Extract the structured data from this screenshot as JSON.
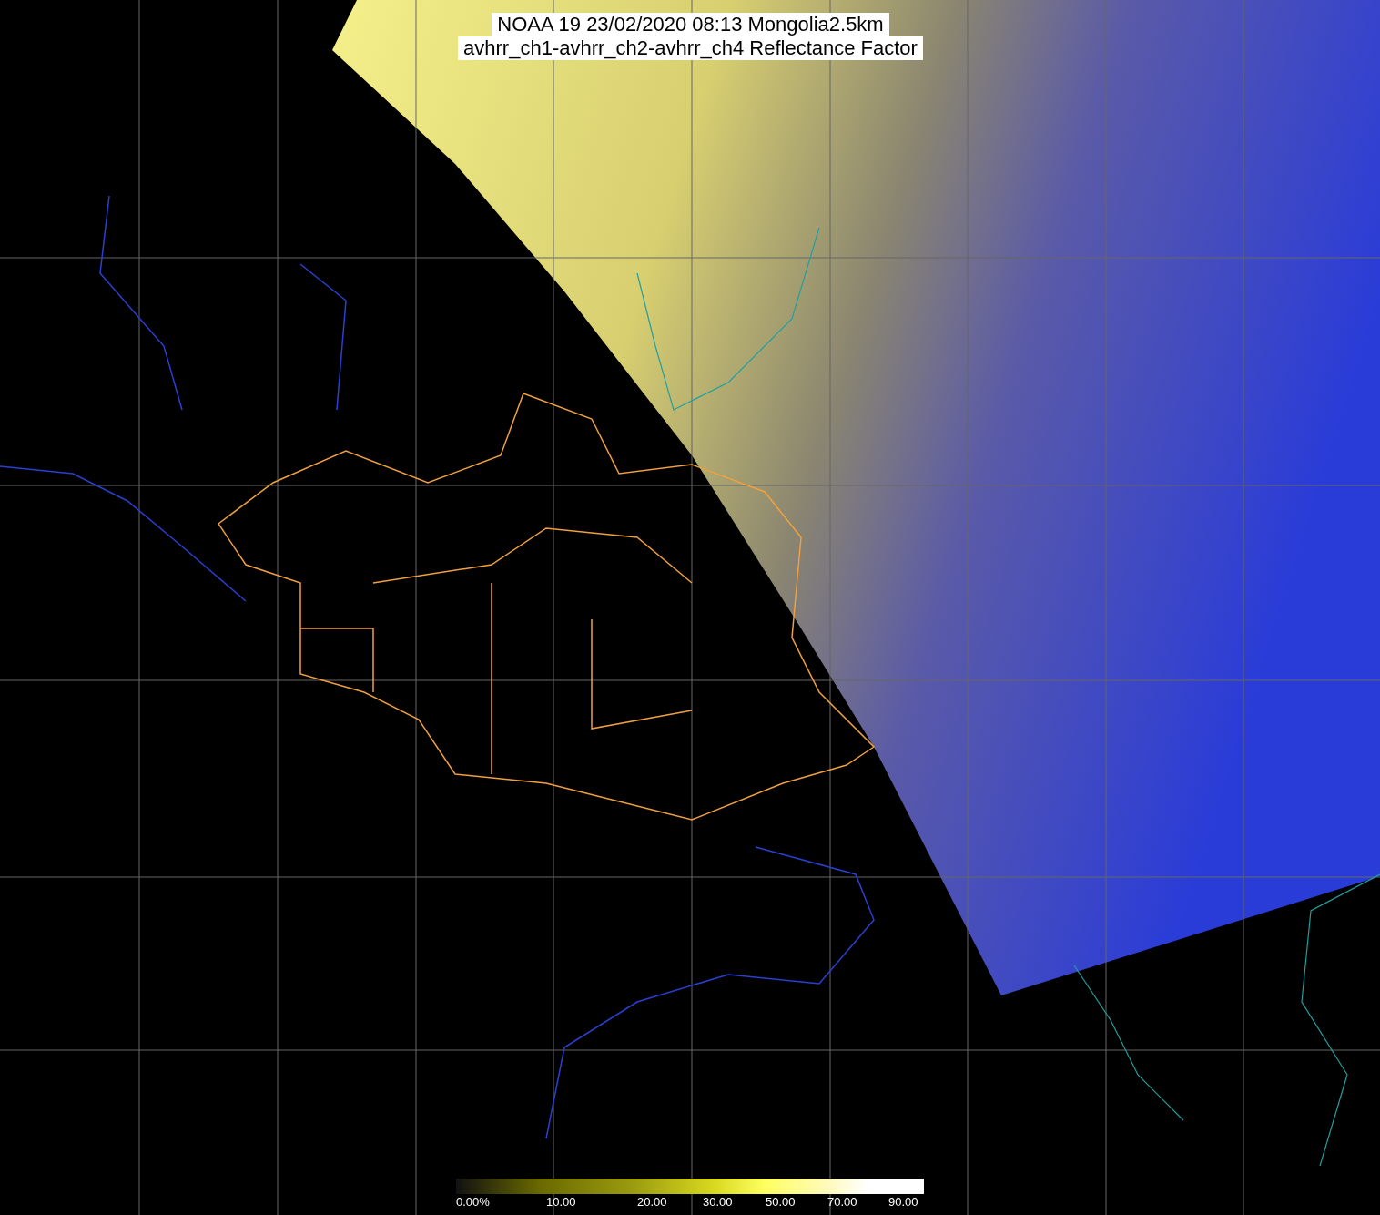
{
  "title": {
    "lines": [
      "NOAA 19 23/02/2020 08:13 Mongolia2.5km",
      "avhrr_ch1-avhrr_ch2-avhrr_ch4 Reflectance Factor"
    ]
  },
  "colorbar": {
    "labels": [
      "0.00%",
      "10.00",
      "20.00",
      "30.00",
      "50.00",
      "70.00",
      "90.00"
    ]
  }
}
